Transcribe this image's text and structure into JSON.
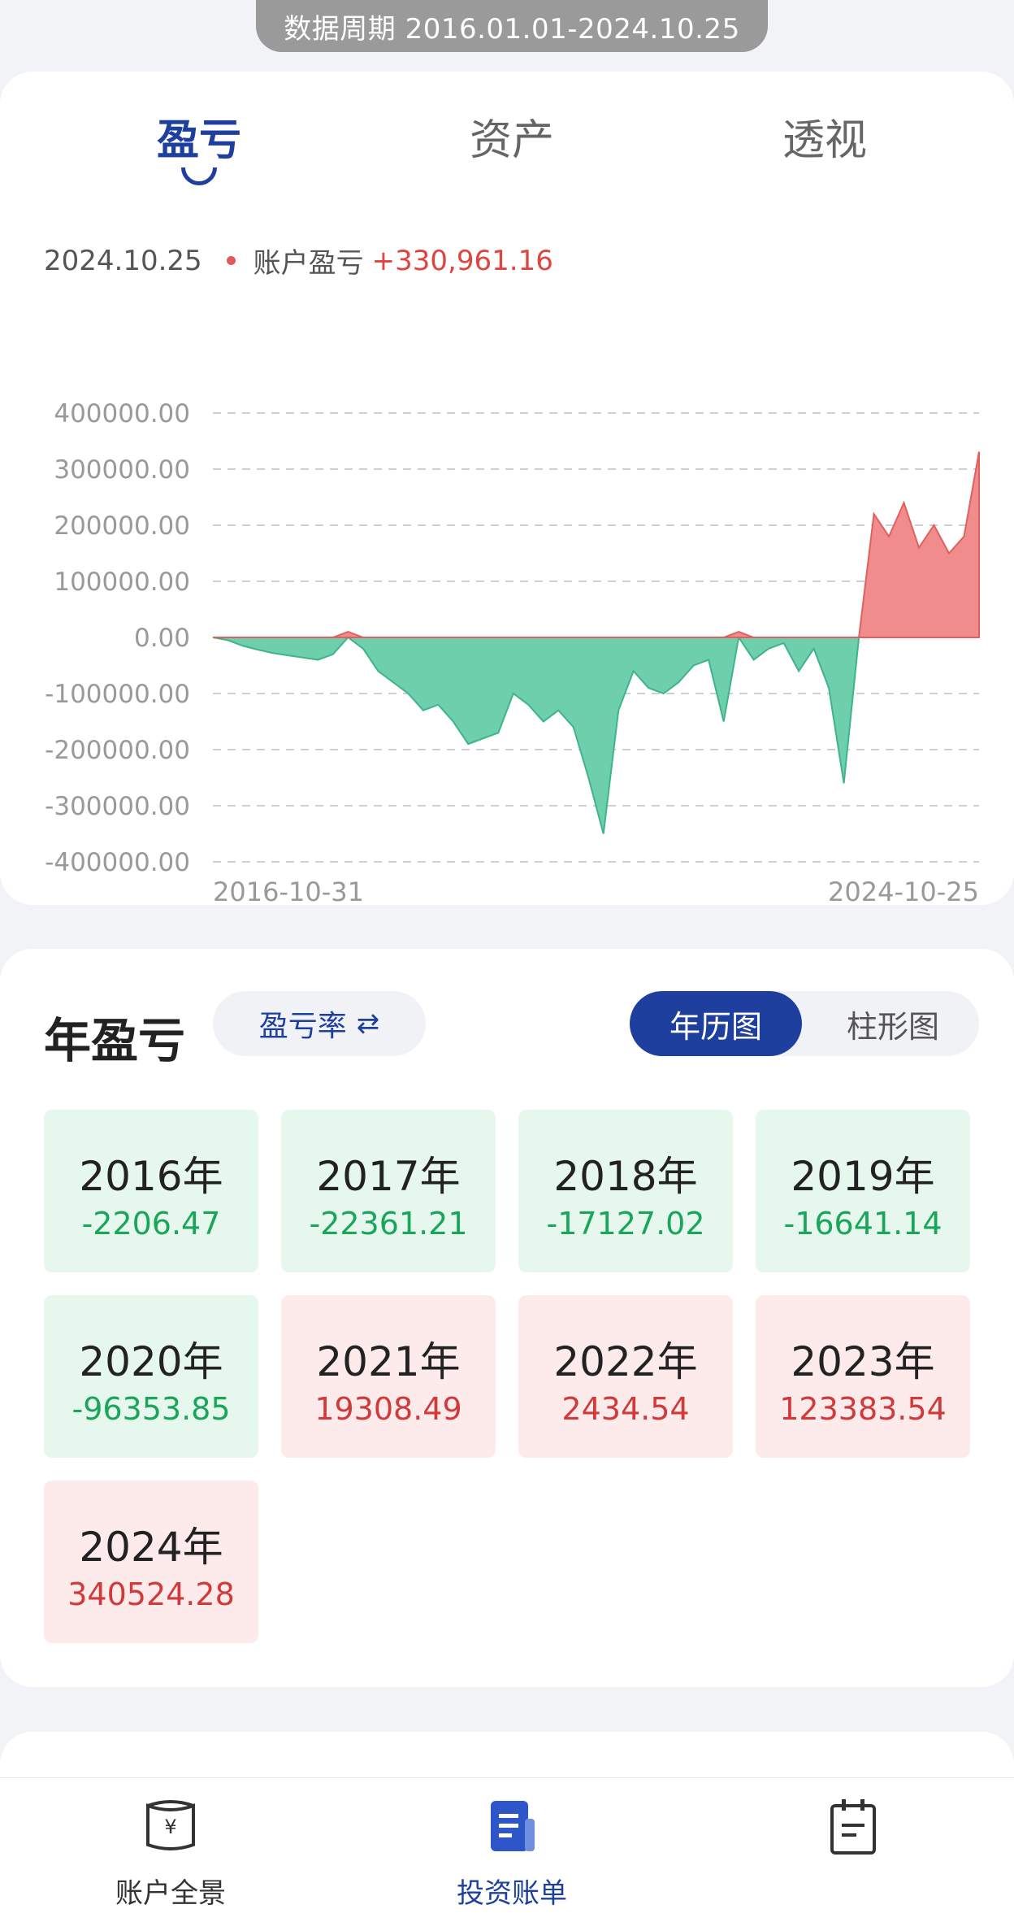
{
  "period_label": "数据周期 2016.01.01-2024.10.25",
  "tabs": [
    {
      "label": "盈亏",
      "active": true
    },
    {
      "label": "资产",
      "active": false
    },
    {
      "label": "透视",
      "active": false
    }
  ],
  "pl_summary": {
    "date": "2024.10.25",
    "label": "账户盈亏",
    "value": "+330,961.16"
  },
  "colors": {
    "accent": "#1f3f9e",
    "gain": "#e0443e",
    "loss": "#1aa55b",
    "gain_fill": "#f08c8c",
    "loss_fill": "#6dcfab"
  },
  "chart_data": {
    "type": "area",
    "ylim": [
      -400000,
      400000
    ],
    "y_ticks": [
      "400000.00",
      "300000.00",
      "200000.00",
      "100000.00",
      "0.00",
      "-100000.00",
      "-200000.00",
      "-300000.00",
      "-400000.00"
    ],
    "x_ticks": [
      "2016-10-31",
      "2024-10-25"
    ],
    "grid": true,
    "x": [
      "2016-10-31",
      "2017-02",
      "2017-06",
      "2017-10",
      "2018-02",
      "2018-06",
      "2018-10",
      "2019-02",
      "2019-04",
      "2019-05",
      "2019-06",
      "2019-07",
      "2019-08",
      "2019-10",
      "2019-12",
      "2020-02",
      "2020-04",
      "2020-06",
      "2020-08",
      "2020-10",
      "2020-12",
      "2021-02",
      "2021-04",
      "2021-06",
      "2021-08",
      "2021-10",
      "2021-12",
      "2022-02",
      "2022-04",
      "2022-05",
      "2022-07",
      "2022-09",
      "2022-11",
      "2023-01",
      "2023-02",
      "2023-04",
      "2023-05",
      "2023-06",
      "2023-08",
      "2023-10",
      "2023-12",
      "2024-01",
      "2024-02",
      "2024-03",
      "2024-04",
      "2024-05",
      "2024-06",
      "2024-07",
      "2024-08",
      "2024-09",
      "2024-10-08",
      "2024-10-25"
    ],
    "values": [
      0,
      -5000,
      -15000,
      -22000,
      -28000,
      -32000,
      -36000,
      -40000,
      -30000,
      10000,
      -20000,
      -60000,
      -80000,
      -100000,
      -130000,
      -120000,
      -150000,
      -190000,
      -180000,
      -170000,
      -100000,
      -120000,
      -150000,
      -130000,
      -160000,
      -250000,
      -350000,
      -130000,
      -60000,
      -90000,
      -100000,
      -80000,
      -50000,
      -40000,
      -150000,
      10000,
      -40000,
      -20000,
      -10000,
      -60000,
      -20000,
      -90000,
      -260000,
      0,
      220000,
      180000,
      240000,
      160000,
      200000,
      150000,
      180000,
      330961
    ]
  },
  "year_section": {
    "title": "年盈亏",
    "toggle_label": "盈亏率",
    "toggle_icon": "swap-icon",
    "views": [
      {
        "label": "年历图",
        "active": true
      },
      {
        "label": "柱形图",
        "active": false
      }
    ]
  },
  "years": [
    {
      "year": "2016年",
      "value": "-2206.47",
      "type": "loss"
    },
    {
      "year": "2017年",
      "value": "-22361.21",
      "type": "loss"
    },
    {
      "year": "2018年",
      "value": "-17127.02",
      "type": "loss"
    },
    {
      "year": "2019年",
      "value": "-16641.14",
      "type": "loss"
    },
    {
      "year": "2020年",
      "value": "-96353.85",
      "type": "loss"
    },
    {
      "year": "2021年",
      "value": "19308.49",
      "type": "gain"
    },
    {
      "year": "2022年",
      "value": "2434.54",
      "type": "gain"
    },
    {
      "year": "2023年",
      "value": "123383.54",
      "type": "gain"
    },
    {
      "year": "2024年",
      "value": "340524.28",
      "type": "gain"
    }
  ],
  "bottom_nav": [
    {
      "label": "账户全景",
      "icon": "wallet-yen-icon",
      "active": false
    },
    {
      "label": "投资账单",
      "icon": "bill-document-icon",
      "active": true
    },
    {
      "label": "",
      "icon": "calendar-notepad-icon",
      "active": false
    }
  ]
}
